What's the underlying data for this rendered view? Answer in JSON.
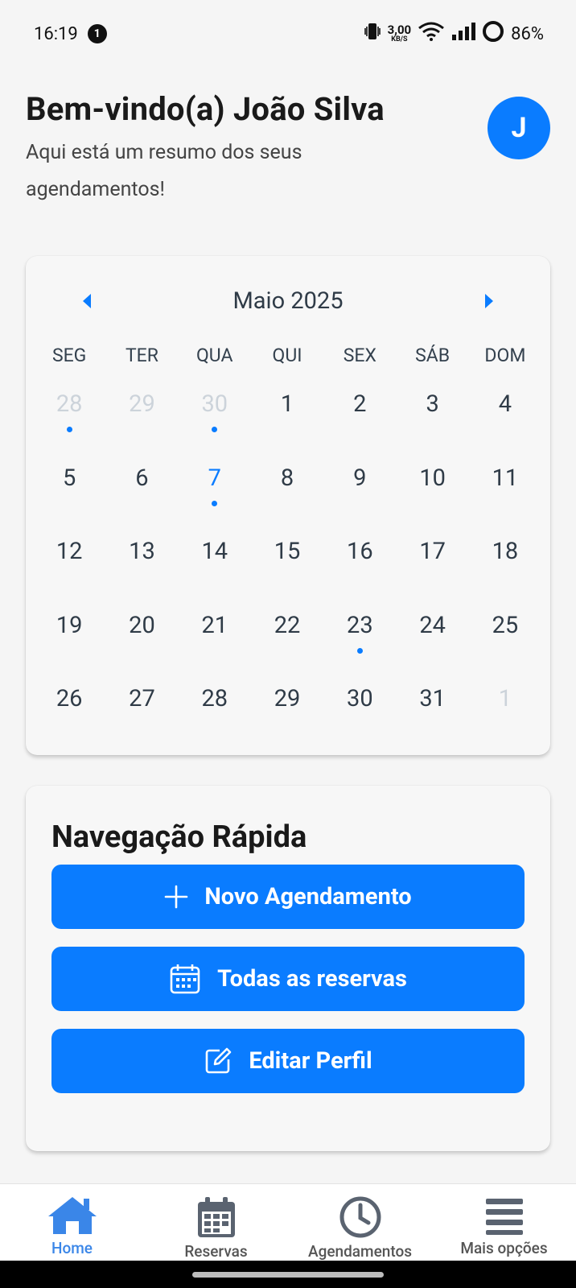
{
  "status_bar": {
    "time": "16:19",
    "notification_count": "1",
    "net_speed_value": "3,00",
    "net_speed_unit": "KB/S",
    "battery": "86%"
  },
  "header": {
    "title": "Bem-vindo(a) João Silva",
    "subtitle": "Aqui está um resumo dos seus agendamentos!",
    "avatar_initial": "J"
  },
  "calendar": {
    "month": "Maio 2025",
    "weekdays": [
      "SEG",
      "TER",
      "QUA",
      "QUI",
      "SEX",
      "SÁB",
      "DOM"
    ],
    "days": [
      {
        "n": "28",
        "muted": true,
        "dot": true
      },
      {
        "n": "29",
        "muted": true,
        "dot": false
      },
      {
        "n": "30",
        "muted": true,
        "dot": true
      },
      {
        "n": "1",
        "muted": false,
        "dot": false
      },
      {
        "n": "2",
        "muted": false,
        "dot": false
      },
      {
        "n": "3",
        "muted": false,
        "dot": false
      },
      {
        "n": "4",
        "muted": false,
        "dot": false
      },
      {
        "n": "5",
        "muted": false,
        "dot": false
      },
      {
        "n": "6",
        "muted": false,
        "dot": false
      },
      {
        "n": "7",
        "muted": false,
        "dot": true,
        "selected": true
      },
      {
        "n": "8",
        "muted": false,
        "dot": false
      },
      {
        "n": "9",
        "muted": false,
        "dot": false
      },
      {
        "n": "10",
        "muted": false,
        "dot": false
      },
      {
        "n": "11",
        "muted": false,
        "dot": false
      },
      {
        "n": "12",
        "muted": false,
        "dot": false
      },
      {
        "n": "13",
        "muted": false,
        "dot": false
      },
      {
        "n": "14",
        "muted": false,
        "dot": false
      },
      {
        "n": "15",
        "muted": false,
        "dot": false
      },
      {
        "n": "16",
        "muted": false,
        "dot": false
      },
      {
        "n": "17",
        "muted": false,
        "dot": false
      },
      {
        "n": "18",
        "muted": false,
        "dot": false
      },
      {
        "n": "19",
        "muted": false,
        "dot": false
      },
      {
        "n": "20",
        "muted": false,
        "dot": false
      },
      {
        "n": "21",
        "muted": false,
        "dot": false
      },
      {
        "n": "22",
        "muted": false,
        "dot": false
      },
      {
        "n": "23",
        "muted": false,
        "dot": true
      },
      {
        "n": "24",
        "muted": false,
        "dot": false
      },
      {
        "n": "25",
        "muted": false,
        "dot": false
      },
      {
        "n": "26",
        "muted": false,
        "dot": false
      },
      {
        "n": "27",
        "muted": false,
        "dot": false
      },
      {
        "n": "28",
        "muted": false,
        "dot": false
      },
      {
        "n": "29",
        "muted": false,
        "dot": false
      },
      {
        "n": "30",
        "muted": false,
        "dot": false
      },
      {
        "n": "31",
        "muted": false,
        "dot": false
      },
      {
        "n": "1",
        "muted": true,
        "dot": false
      }
    ]
  },
  "quick_nav": {
    "title": "Navegação Rápida",
    "buttons": [
      {
        "label": "Novo Agendamento",
        "icon": "plus-icon"
      },
      {
        "label": "Todas as reservas",
        "icon": "calendar-icon"
      },
      {
        "label": "Editar Perfil",
        "icon": "edit-icon"
      }
    ]
  },
  "bottom_nav": {
    "items": [
      {
        "label": "Home",
        "icon": "home-icon",
        "active": true
      },
      {
        "label": "Reservas",
        "icon": "calendar-icon",
        "active": false
      },
      {
        "label": "Agendamentos",
        "icon": "clock-icon",
        "active": false
      },
      {
        "label": "Mais opções",
        "icon": "menu-icon",
        "active": false
      }
    ]
  },
  "colors": {
    "accent": "#0a7cff",
    "background": "#f5f5f5",
    "muted_day": "#ccd3da",
    "active_nav": "#3a86e8",
    "inactive_nav": "#555555"
  }
}
